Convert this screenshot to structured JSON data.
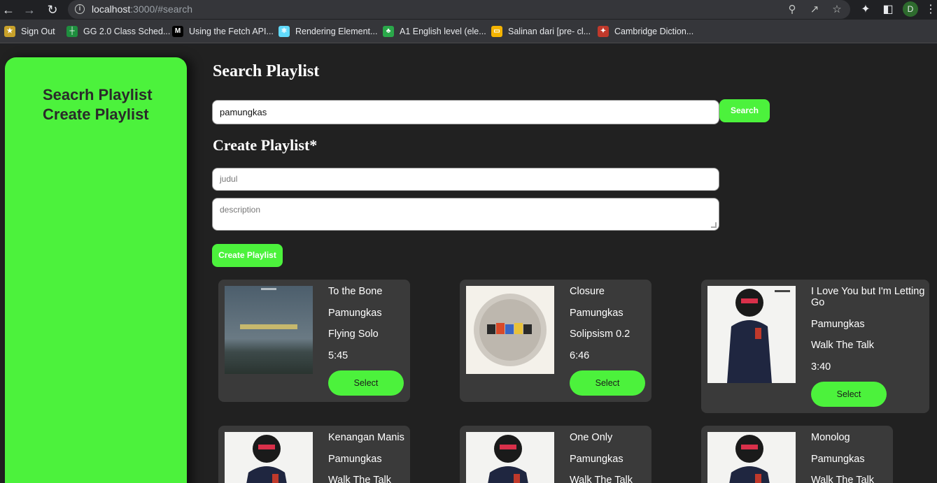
{
  "browser": {
    "url_host": "localhost",
    "url_rest": ":3000/#search",
    "profile_initial": "D",
    "bookmarks": [
      {
        "label": "Sign Out",
        "icon": "sign-out-icon",
        "color": "#c8a12a"
      },
      {
        "label": "GG 2.0 Class Sched...",
        "icon": "sheets-icon",
        "color": "#1e8e3e"
      },
      {
        "label": "Using the Fetch API...",
        "icon": "mdn-icon",
        "color": "#000000"
      },
      {
        "label": "Rendering Element...",
        "icon": "react-icon",
        "color": "#61dafb"
      },
      {
        "label": "A1 English level (ele...",
        "icon": "clover-icon",
        "color": "#2aa84a"
      },
      {
        "label": "Salinan dari [pre- cl...",
        "icon": "slides-icon",
        "color": "#f4b400"
      },
      {
        "label": "Cambridge Diction...",
        "icon": "cambridge-icon",
        "color": "#c0392b"
      }
    ]
  },
  "sidebar": {
    "items": [
      {
        "label": "Seacrh Playlist"
      },
      {
        "label": "Create Playlist"
      }
    ]
  },
  "search": {
    "title": "Search Playlist",
    "value": "pamungkas",
    "button_label": "Search"
  },
  "create": {
    "title": "Create Playlist*",
    "title_placeholder": "judul",
    "description_placeholder": "description",
    "button_label": "Create Playlist"
  },
  "tracks": [
    {
      "title": "To the Bone",
      "artist": "Pamungkas",
      "album": "Flying Solo",
      "duration": "5:45",
      "select_label": "Select",
      "cover": "flying-solo-cover"
    },
    {
      "title": "Closure",
      "artist": "Pamungkas",
      "album": "Solipsism 0.2",
      "duration": "6:46",
      "select_label": "Select",
      "cover": "solipsism-cover"
    },
    {
      "title": "I Love You but I'm Letting Go",
      "artist": "Pamungkas",
      "album": "Walk The Talk",
      "duration": "3:40",
      "select_label": "Select",
      "cover": "walk-the-talk-cover"
    },
    {
      "title": "Kenangan Manis",
      "artist": "Pamungkas",
      "album": "Walk The Talk",
      "cover": "walk-the-talk-cover"
    },
    {
      "title": "One Only",
      "artist": "Pamungkas",
      "album": "Walk The Talk",
      "cover": "walk-the-talk-cover"
    },
    {
      "title": "Monolog",
      "artist": "Pamungkas",
      "album": "Walk The Talk",
      "cover": "walk-the-talk-cover"
    }
  ],
  "colors": {
    "accent": "#4cf23c",
    "background": "#212121",
    "card": "#3a3a3a"
  }
}
